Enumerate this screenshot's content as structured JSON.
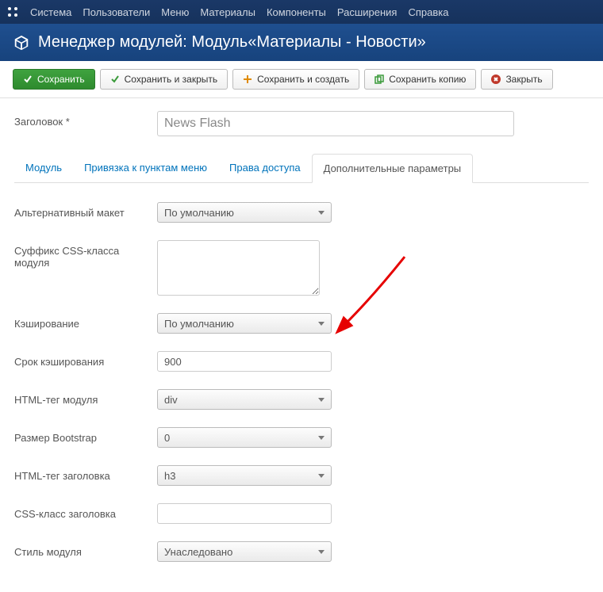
{
  "topnav": {
    "items": [
      "Система",
      "Пользователи",
      "Меню",
      "Материалы",
      "Компоненты",
      "Расширения",
      "Справка"
    ]
  },
  "title": "Менеджер модулей: Модуль«Материалы - Новости»",
  "toolbar": {
    "save": "Сохранить",
    "save_close": "Сохранить и закрыть",
    "save_new": "Сохранить и создать",
    "save_copy": "Сохранить копию",
    "close": "Закрыть"
  },
  "header_field": {
    "label": "Заголовок",
    "value": "News Flash"
  },
  "tabs": [
    "Модуль",
    "Привязка к пунктам меню",
    "Права доступа",
    "Дополнительные параметры"
  ],
  "active_tab": 3,
  "fields": {
    "alt_layout": {
      "label": "Альтернативный макет",
      "value": "По умолчанию"
    },
    "css_suffix": {
      "label": "Суффикс CSS-класса модуля",
      "value": ""
    },
    "caching": {
      "label": "Кэширование",
      "value": "По умолчанию"
    },
    "cache_time": {
      "label": "Срок кэширования",
      "value": "900"
    },
    "module_tag": {
      "label": "HTML-тег модуля",
      "value": "div"
    },
    "bootstrap_size": {
      "label": "Размер Bootstrap",
      "value": "0"
    },
    "header_tag": {
      "label": "HTML-тег заголовка",
      "value": "h3"
    },
    "header_class": {
      "label": "CSS-класс заголовка",
      "value": ""
    },
    "module_style": {
      "label": "Стиль модуля",
      "value": "Унаследовано"
    }
  },
  "arrow_color": "#e60000"
}
